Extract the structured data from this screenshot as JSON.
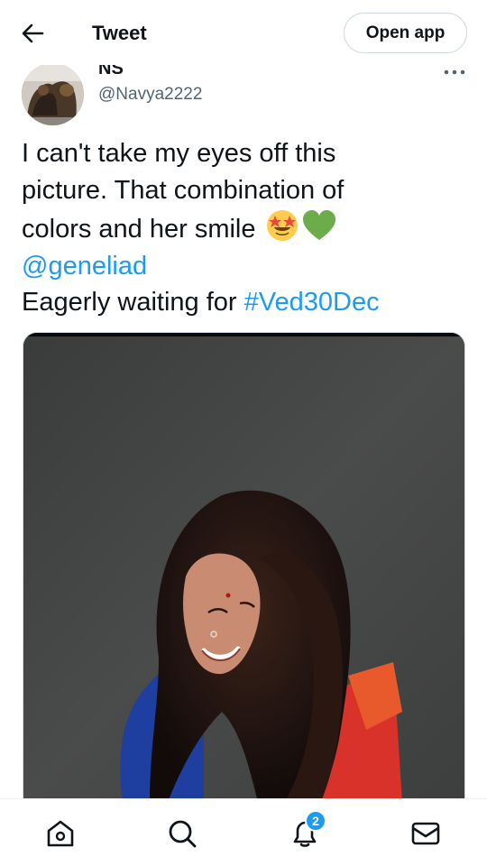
{
  "header": {
    "title": "Tweet",
    "open_app_label": "Open app",
    "back_icon": "arrow-left-icon"
  },
  "author": {
    "display_name": "NS",
    "handle": "@Navya2222",
    "more_icon": "more-dots-icon"
  },
  "tweet": {
    "line1": "I can't take my eyes off this",
    "line2": "picture. That combination of",
    "line3": "colors and her smile",
    "emojis": [
      "star-struck-emoji",
      "green-heart-emoji"
    ],
    "mention": "@geneliad",
    "line5_prefix": "Eagerly waiting for ",
    "hashtag": "#Ved30Dec"
  },
  "media": {
    "type": "photo"
  },
  "bottom_nav": {
    "items": [
      {
        "name": "home",
        "icon": "home-icon"
      },
      {
        "name": "explore",
        "icon": "search-icon"
      },
      {
        "name": "notifications",
        "icon": "bell-icon"
      },
      {
        "name": "messages",
        "icon": "mail-icon"
      }
    ],
    "notifications_badge": "2"
  },
  "colors": {
    "link": "#1d9bf0",
    "text": "#0f1419",
    "secondary_text": "#536471",
    "border": "#cfd9de"
  }
}
